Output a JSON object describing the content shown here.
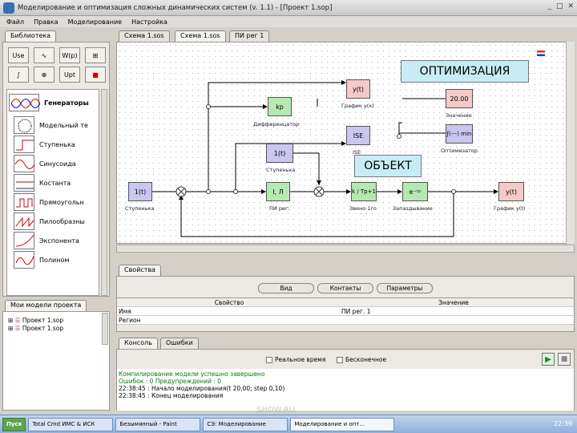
{
  "window": {
    "title": "Моделирование и оптимизация сложных динамических систем (v. 1.1) - [Проект 1.sop]",
    "controls": [
      "_",
      "□",
      "✕"
    ]
  },
  "menu": [
    "Файл",
    "Правка",
    "Моделирование",
    "Настройка"
  ],
  "left_tab": "Библиотека",
  "editor_tabs": [
    "Схема 1.sos",
    "Схема 1.sos",
    "ПИ рег 1"
  ],
  "toolbar": [
    "Use",
    "∿",
    "W(p)",
    "⊞",
    "∫",
    "⊕",
    "Upt",
    "■"
  ],
  "palette": [
    {
      "label": "Генераторы",
      "bold": true
    },
    {
      "label": "Модельный те"
    },
    {
      "label": "Ступенька"
    },
    {
      "label": "Синусоида"
    },
    {
      "label": "Костанта"
    },
    {
      "label": "Прямоугольн"
    },
    {
      "label": "Пилообразны"
    },
    {
      "label": "Экспонента"
    },
    {
      "label": "Полином"
    }
  ],
  "diagram": {
    "blocks": [
      {
        "id": "step1",
        "text": "1(t)",
        "label": "Ступенька"
      },
      {
        "id": "pi",
        "text": "I, Л",
        "label": "ПИ рег."
      },
      {
        "id": "kp",
        "text": "kp",
        "label": "Дифференцатор"
      },
      {
        "id": "step2",
        "text": "1(t)",
        "label": "Ступенька"
      },
      {
        "id": "yt",
        "text": "y(t)",
        "label": "График y(x)"
      },
      {
        "id": "ise",
        "text": "ISE",
        "label": "ISE"
      },
      {
        "id": "val",
        "text": "20.00",
        "label": "Значение"
      },
      {
        "id": "opt",
        "text": "ƒ(---) min",
        "label": "Оптимизатор"
      },
      {
        "id": "tf",
        "text": "k / Tp+1",
        "label": "Звено 1го"
      },
      {
        "id": "delay",
        "text": "e⁻ᵗᵖ",
        "label": "Запаздывание"
      },
      {
        "id": "graph2",
        "text": "y(t)",
        "label": "График y(t)"
      }
    ],
    "optimization_label": "ОПТИМИЗАЦИЯ",
    "object_label": "ОБЪЕКТ"
  },
  "props": {
    "tab": "Свойства",
    "buttons": [
      "Вид",
      "Контакты",
      "Параметры"
    ],
    "headers": [
      "Свойство",
      "Значение"
    ],
    "rows": [
      [
        "Имя",
        "ПИ рег. 1"
      ],
      [
        "Регион",
        ""
      ]
    ]
  },
  "tree": {
    "tab": "Мои модели проекта",
    "items": [
      "Проект 1.sop",
      "Проект 1.sop"
    ]
  },
  "console": {
    "tabs": [
      "Консоль",
      "Ошибки"
    ],
    "options": [
      "Реальное время",
      "Бесконечное"
    ],
    "lines": [
      {
        "text": "Компилирование модели успешно завершено",
        "color": "#0a7a0a"
      },
      {
        "text": "Ошибок : 0  Предупреждений : 0",
        "color": "#0a7a0a"
      },
      {
        "text": "22:38:45 : Начало моделирования(t       20,00; step   0,10)",
        "color": "#000"
      },
      {
        "text": "22:38:45 : Конец моделирования",
        "color": "#000"
      }
    ]
  },
  "taskbar": {
    "start": "Пуск",
    "tasks": [
      "Total Cmd ИМС & ИСК",
      "Безымянный - Paint",
      "СЭ: Моделирование",
      "Моделирование и опт..."
    ],
    "clock": "22:39",
    "watermark": "SHOW.RU"
  },
  "colors": {
    "block_purple": "#c9c6ef",
    "block_green": "#b6e8b2",
    "block_pink": "#f6c9c9",
    "box_cyan": "#c8ecf6"
  }
}
